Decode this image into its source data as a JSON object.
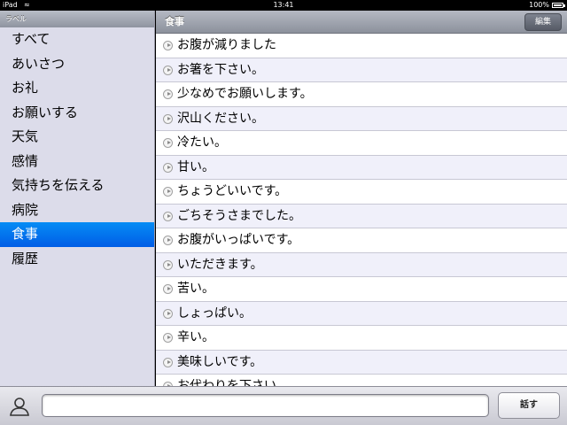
{
  "statusbar": {
    "carrier": "iPad",
    "time": "13:41",
    "battery": "100%",
    "battery_level": 1.0
  },
  "sidebar": {
    "header": "ラベル",
    "items": [
      {
        "label": "すべて",
        "selected": false
      },
      {
        "label": "あいさつ",
        "selected": false
      },
      {
        "label": "お礼",
        "selected": false
      },
      {
        "label": "お願いする",
        "selected": false
      },
      {
        "label": "天気",
        "selected": false
      },
      {
        "label": "感情",
        "selected": false
      },
      {
        "label": "気持ちを伝える",
        "selected": false
      },
      {
        "label": "病院",
        "selected": false
      },
      {
        "label": "食事",
        "selected": true
      },
      {
        "label": "履歴",
        "selected": false
      }
    ]
  },
  "main": {
    "title": "食事",
    "edit_label": "編集",
    "rows": [
      "お腹が減りました",
      "お箸を下さい。",
      "少なめでお願いします。",
      "沢山ください。",
      "冷たい。",
      "甘い。",
      "ちょうどいいです。",
      "ごちそうさまでした。",
      "お腹がいっぱいです。",
      "いただきます。",
      "苦い。",
      "しょっぱい。",
      "辛い。",
      "美味しいです。",
      "お代わりを下さい。"
    ]
  },
  "bottombar": {
    "input_value": "",
    "speak_label": "話す"
  },
  "colors": {
    "selected": "#0a6cf0",
    "sidebar_bg": "#dcdcea",
    "row_alt": "#f0f0fa"
  }
}
